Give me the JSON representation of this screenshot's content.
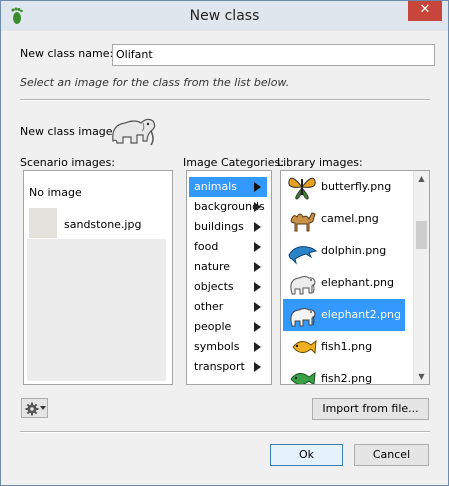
{
  "window": {
    "title": "New class"
  },
  "form": {
    "class_name_label": "New class name:",
    "class_name_value": "Olifant",
    "instruction": "Select an image for the class from the list below.",
    "class_image_label": "New class image:"
  },
  "scenario": {
    "label": "Scenario images:",
    "items": [
      {
        "label": "No image"
      },
      {
        "label": "sandstone.jpg"
      }
    ]
  },
  "categories": {
    "label": "Image Categories:",
    "selected": "animals",
    "items": [
      {
        "label": "animals"
      },
      {
        "label": "backgrounds"
      },
      {
        "label": "buildings"
      },
      {
        "label": "food"
      },
      {
        "label": "nature"
      },
      {
        "label": "objects"
      },
      {
        "label": "other"
      },
      {
        "label": "people"
      },
      {
        "label": "symbols"
      },
      {
        "label": "transport"
      }
    ]
  },
  "library": {
    "label": "Library images:",
    "selected": "elephant2.png",
    "items": [
      {
        "label": "butterfly.png",
        "icon": "butterfly-icon"
      },
      {
        "label": "camel.png",
        "icon": "camel-icon"
      },
      {
        "label": "dolphin.png",
        "icon": "dolphin-icon"
      },
      {
        "label": "elephant.png",
        "icon": "elephant-icon"
      },
      {
        "label": "elephant2.png",
        "icon": "elephant2-icon"
      },
      {
        "label": "fish1.png",
        "icon": "fish1-icon"
      },
      {
        "label": "fish2.png",
        "icon": "fish2-icon"
      }
    ]
  },
  "buttons": {
    "import": "Import from file...",
    "ok": "Ok",
    "cancel": "Cancel"
  },
  "colors": {
    "selection": "#3399ff",
    "close": "#c7453a",
    "titlebar": "#dfe6ee"
  }
}
